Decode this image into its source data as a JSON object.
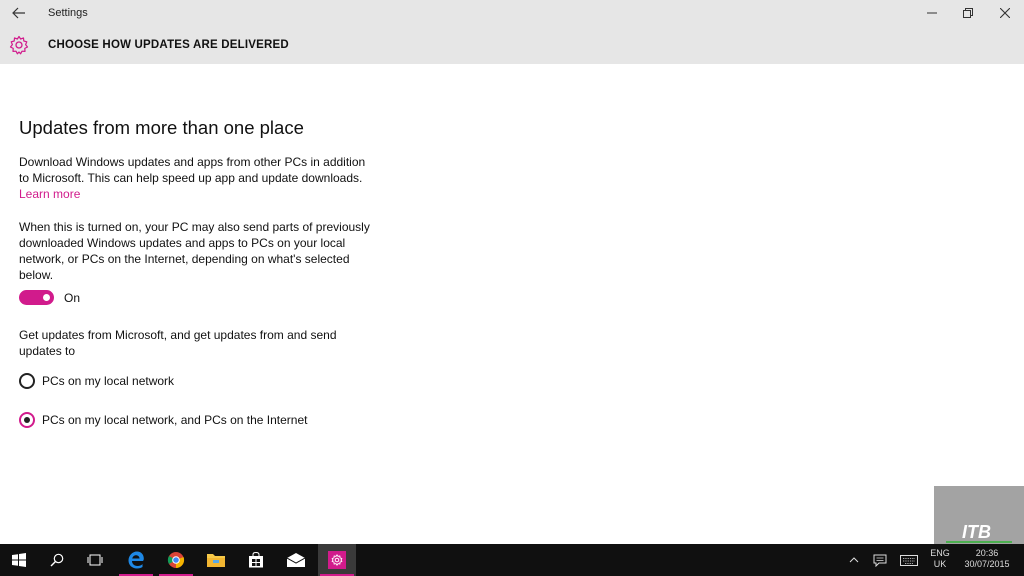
{
  "window": {
    "title": "Settings"
  },
  "header": {
    "title": "CHOOSE HOW UPDATES ARE DELIVERED",
    "icon": "gear-icon"
  },
  "main": {
    "section_title": "Updates from more than one place",
    "description": "Download Windows updates and apps from other PCs in addition to Microsoft. This can help speed up app and update downloads.",
    "learn_more": "Learn more",
    "send_description": "When this is turned on, your PC may also send parts of previously downloaded Windows updates and apps to PCs on your local network, or PCs on the Internet, depending on what's selected below.",
    "toggle": {
      "state": "On",
      "on": true
    },
    "get_updates_label": "Get updates from Microsoft, and get updates from and send updates to",
    "options": [
      {
        "label": "PCs on my local network",
        "selected": false
      },
      {
        "label": "PCs on my local network, and PCs on the Internet",
        "selected": true
      }
    ]
  },
  "watermark": {
    "text": "ITB"
  },
  "taskbar": {
    "language": "ENG",
    "region": "UK",
    "time": "20:36",
    "date": "30/07/2015"
  },
  "colors": {
    "accent": "#d11b8c",
    "titlebar": "#e6e6e6",
    "taskbar": "#101010"
  }
}
